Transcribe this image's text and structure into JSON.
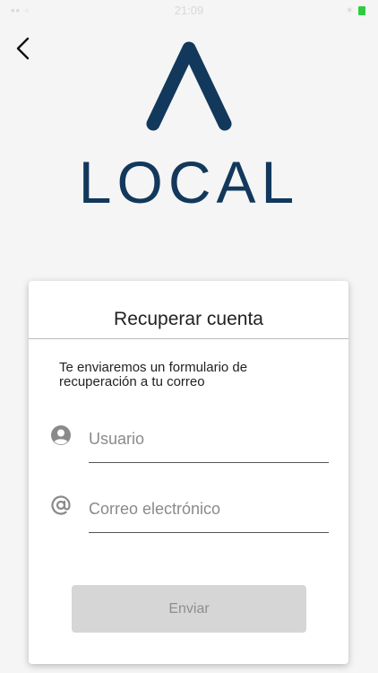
{
  "status_bar": {
    "left": "•• ◦",
    "time": "21:09"
  },
  "header": {
    "back_icon": "chevron-left-icon"
  },
  "logo": {
    "text": "LOCAL",
    "color": "#12385c"
  },
  "card": {
    "title": "Recuperar cuenta",
    "description": "Te enviaremos un formulario de recuperación a tu correo",
    "fields": [
      {
        "icon": "user-circle-icon",
        "placeholder": "Usuario",
        "value": ""
      },
      {
        "icon": "at-sign-icon",
        "placeholder": "Correo electrónico",
        "value": ""
      }
    ],
    "submit_label": "Enviar"
  },
  "colors": {
    "background": "#f5f5f5",
    "brand": "#12385c",
    "button_disabled": "#d6d6d6",
    "button_text_disabled": "#8e8e8e"
  }
}
